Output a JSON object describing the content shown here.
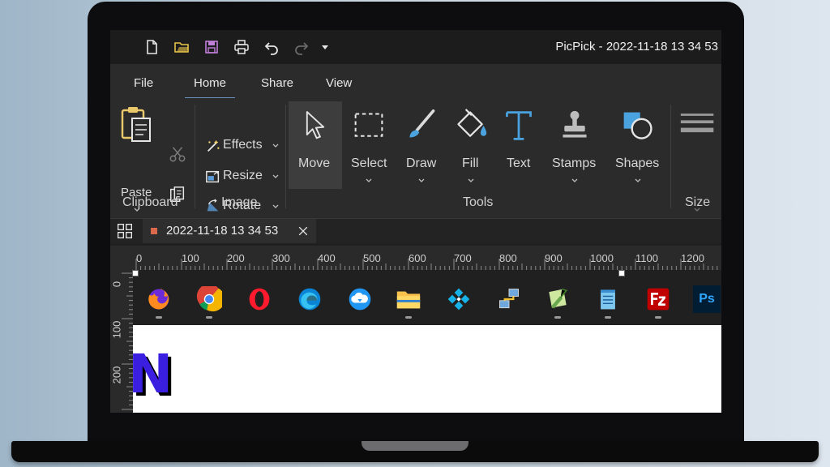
{
  "window": {
    "title": "PicPick - 2022-11-18 13 34 53"
  },
  "quick_access": [
    {
      "name": "new-file-icon"
    },
    {
      "name": "open-folder-icon"
    },
    {
      "name": "save-icon"
    },
    {
      "name": "print-icon"
    },
    {
      "name": "undo-icon"
    },
    {
      "name": "redo-icon"
    },
    {
      "name": "customize-dropdown-icon"
    }
  ],
  "menu": {
    "tabs": [
      {
        "label": "File"
      },
      {
        "label": "Home",
        "active": true
      },
      {
        "label": "Share"
      },
      {
        "label": "View"
      }
    ]
  },
  "ribbon": {
    "clipboard": {
      "group_label": "Clipboard",
      "paste_label": "Paste"
    },
    "image": {
      "group_label": "Image",
      "effects_label": "Effects",
      "resize_label": "Resize",
      "rotate_label": "Rotate"
    },
    "tools": {
      "group_label": "Tools",
      "items": [
        {
          "label": "Move",
          "active": true
        },
        {
          "label": "Select"
        },
        {
          "label": "Draw"
        },
        {
          "label": "Fill"
        },
        {
          "label": "Text"
        },
        {
          "label": "Stamps"
        },
        {
          "label": "Shapes"
        }
      ]
    },
    "size": {
      "group_label": "Size"
    }
  },
  "document_tab": {
    "title": "2022-11-18 13 34 53"
  },
  "ruler": {
    "horizontal": [
      "0",
      "100",
      "200",
      "300",
      "400",
      "500",
      "600",
      "700",
      "800",
      "900",
      "1000",
      "1100",
      "1200"
    ],
    "vertical": [
      "0",
      "100",
      "200"
    ]
  },
  "canvas": {
    "taskbar_apps": [
      {
        "name": "firefox-icon",
        "running": true
      },
      {
        "name": "chrome-icon",
        "running": true
      },
      {
        "name": "opera-icon",
        "running": false
      },
      {
        "name": "edge-icon",
        "running": false
      },
      {
        "name": "cloud-app-icon",
        "running": false
      },
      {
        "name": "file-explorer-icon",
        "running": true
      },
      {
        "name": "kodi-icon",
        "running": false
      },
      {
        "name": "network-app-icon",
        "running": false
      },
      {
        "name": "notepadpp-icon",
        "running": true
      },
      {
        "name": "notepad-icon",
        "running": true
      },
      {
        "name": "filezilla-icon",
        "running": true
      },
      {
        "name": "photoshop-icon",
        "running": false
      }
    ],
    "photoshop_text": "Ps",
    "corner_logo_text": "N"
  },
  "colors": {
    "accent": "#6a8fbf",
    "tab_marker": "#d9684c",
    "logo": "#3b1fe0"
  }
}
